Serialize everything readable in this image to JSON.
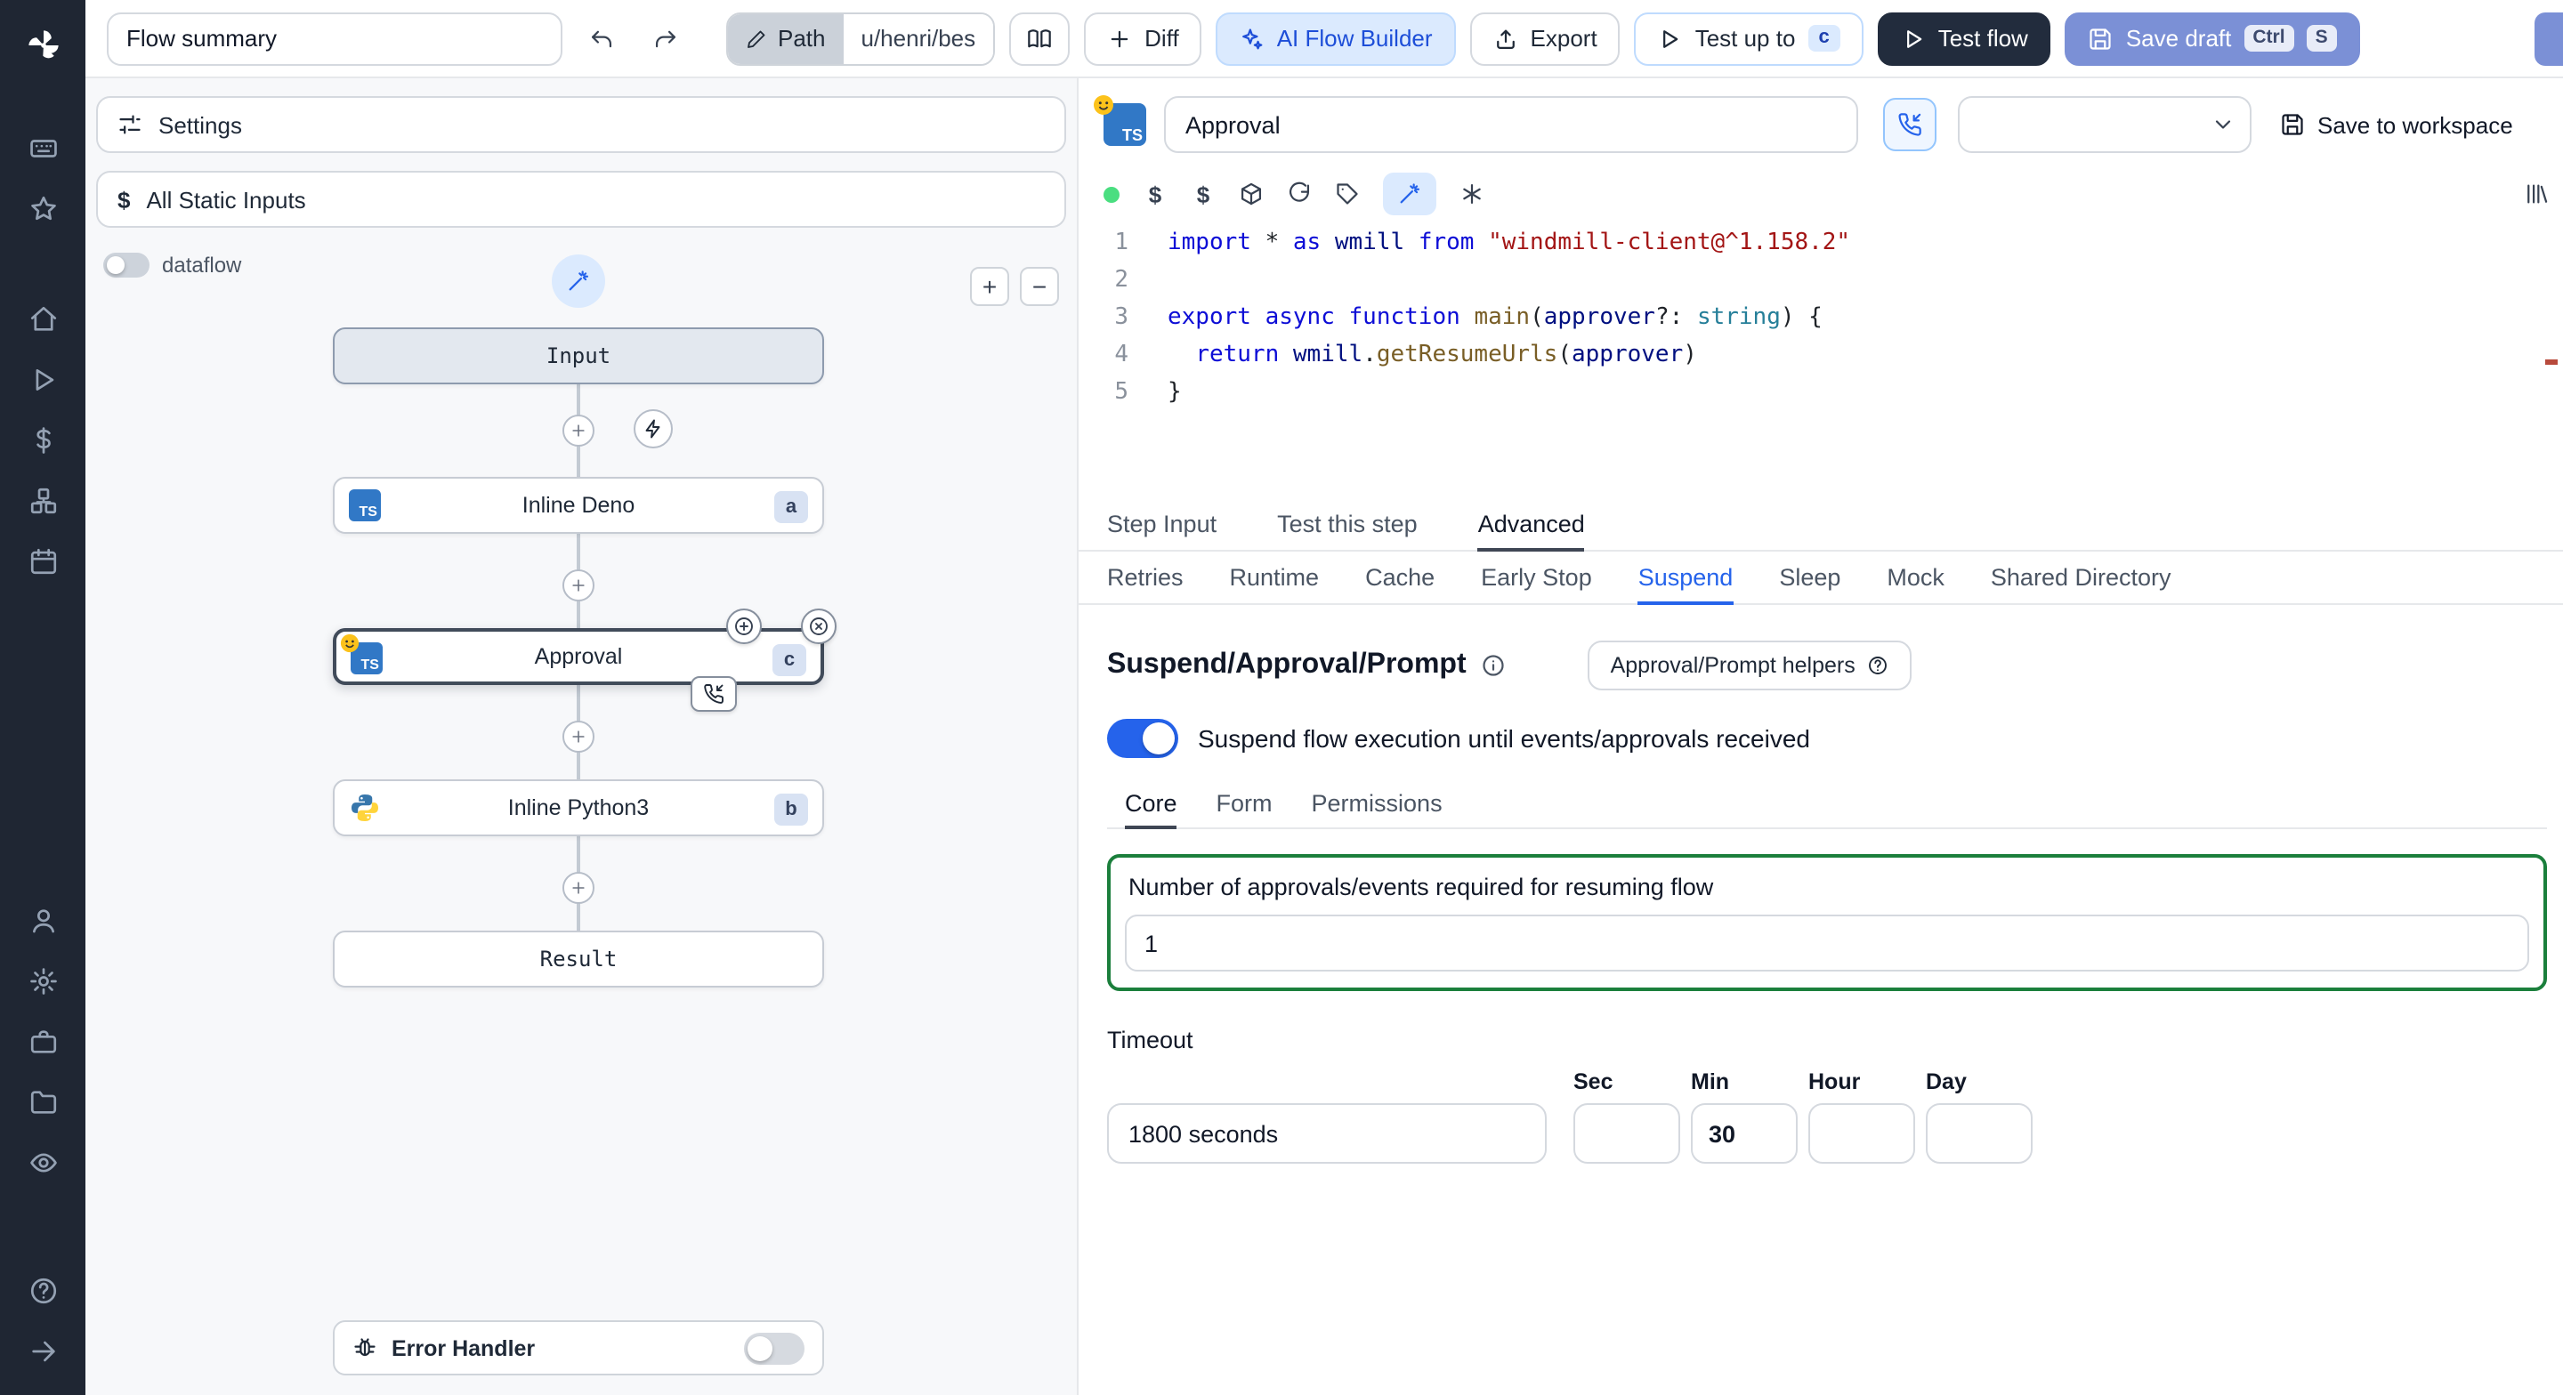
{
  "colors": {
    "accent_blue": "#2563eb",
    "save_draft_blue": "#7b90d6",
    "dark_button": "#222c3d",
    "badge_bg": "#d8e2f3",
    "green_border": "#1b7f3c",
    "status_green": "#4ade80",
    "ts_blue": "#3178c6",
    "sidebar_bg": "#1f2633"
  },
  "icons": {
    "logo": "windmill-pinwheel",
    "sidebar": [
      "keyboard-icon",
      "star-icon",
      "home-icon",
      "play-icon",
      "dollar-icon",
      "boxes-icon",
      "calendar-icon",
      "user-icon",
      "gear-icon",
      "briefcase-icon",
      "folder-icon",
      "eye-icon",
      "help-icon",
      "arrow-right-icon"
    ],
    "editor_toolbar": [
      "status-dot",
      "dollar-icon",
      "dollar-icon",
      "package-icon",
      "refresh-icon",
      "tag-icon",
      "wand-icon",
      "asterisk-icon",
      "library-icon"
    ]
  },
  "topbar": {
    "flow_summary": "Flow summary",
    "path_label": "Path",
    "path_value": "u/henri/bes",
    "diff": "Diff",
    "ai_builder": "AI Flow Builder",
    "export": "Export",
    "test_up_to": "Test up to",
    "test_up_to_badge": "c",
    "test_flow": "Test flow",
    "save_draft": "Save draft",
    "kbd_ctrl": "Ctrl",
    "kbd_s": "S"
  },
  "flow_panel": {
    "settings": "Settings",
    "static_inputs": "All Static Inputs",
    "dataflow": "dataflow",
    "zoom_in": "+",
    "zoom_out": "−",
    "nodes": {
      "input": "Input",
      "deno": {
        "label": "Inline Deno",
        "badge": "a"
      },
      "approval": {
        "label": "Approval",
        "badge": "c"
      },
      "python": {
        "label": "Inline Python3",
        "badge": "b"
      },
      "result": "Result"
    },
    "error_handler": "Error Handler"
  },
  "step": {
    "name": "Approval",
    "save_to_workspace": "Save to workspace"
  },
  "editor": {
    "language_badge": "TS",
    "code_lines": [
      [
        [
          "import",
          "kw"
        ],
        [
          " ",
          "pl"
        ],
        [
          "*",
          "pl"
        ],
        [
          " ",
          "pl"
        ],
        [
          "as",
          "kw"
        ],
        [
          " ",
          "pl"
        ],
        [
          "wmill",
          "var"
        ],
        [
          " ",
          "pl"
        ],
        [
          "from",
          "kw"
        ],
        [
          " ",
          "pl"
        ],
        [
          "\"windmill-client@^1.158.2\"",
          "str"
        ]
      ],
      [],
      [
        [
          "export",
          "kw"
        ],
        [
          " ",
          "pl"
        ],
        [
          "async",
          "kw"
        ],
        [
          " ",
          "pl"
        ],
        [
          "function",
          "kw"
        ],
        [
          " ",
          "pl"
        ],
        [
          "main",
          "fn"
        ],
        [
          "(",
          "pl"
        ],
        [
          "approver",
          "var"
        ],
        [
          "?: ",
          "pl"
        ],
        [
          "string",
          "type"
        ],
        [
          ") {",
          "pl"
        ]
      ],
      [
        [
          "  ",
          "pl"
        ],
        [
          "return",
          "kw"
        ],
        [
          " ",
          "pl"
        ],
        [
          "wmill",
          "var"
        ],
        [
          ".",
          "pl"
        ],
        [
          "getResumeUrls",
          "fn"
        ],
        [
          "(",
          "pl"
        ],
        [
          "approver",
          "var"
        ],
        [
          ")",
          "pl"
        ]
      ],
      [
        [
          "}",
          "pl"
        ]
      ]
    ]
  },
  "tabs": {
    "items": [
      "Step Input",
      "Test this step",
      "Advanced"
    ],
    "active": "Advanced"
  },
  "advanced_tabs": {
    "items": [
      "Retries",
      "Runtime",
      "Cache",
      "Early Stop",
      "Suspend",
      "Sleep",
      "Mock",
      "Shared Directory"
    ],
    "active": "Suspend"
  },
  "suspend": {
    "title": "Suspend/Approval/Prompt",
    "helpers": "Approval/Prompt helpers",
    "toggle_label": "Suspend flow execution until events/approvals received",
    "sub_tabs": [
      "Core",
      "Form",
      "Permissions"
    ],
    "active_sub": "Core",
    "approvals_label": "Number of approvals/events required for resuming flow",
    "approvals_value": "1",
    "timeout_label": "Timeout",
    "timeout_value": "1800 seconds",
    "units": [
      "Sec",
      "Min",
      "Hour",
      "Day"
    ],
    "min_unit": "Min",
    "min_value": "30"
  }
}
